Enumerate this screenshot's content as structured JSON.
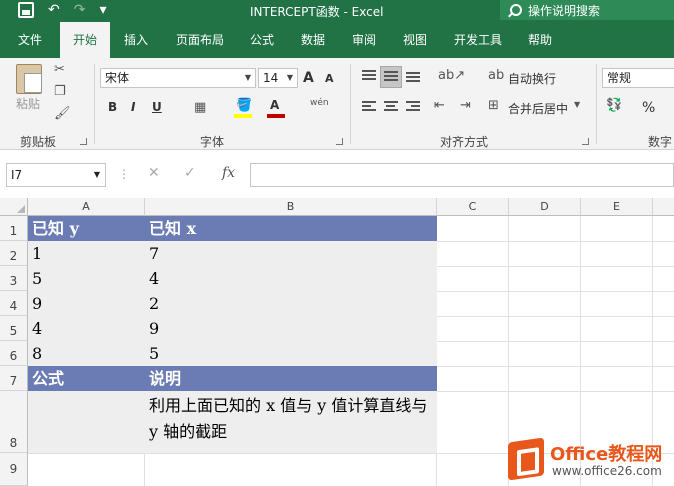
{
  "window": {
    "title": "INTERCEPT函数 - Excel",
    "tell_me": "操作说明搜索"
  },
  "qat": {
    "undo": "↶",
    "redo": "↷",
    "more": "▾"
  },
  "tabs": [
    {
      "label": "文件"
    },
    {
      "label": "开始"
    },
    {
      "label": "插入"
    },
    {
      "label": "页面布局"
    },
    {
      "label": "公式"
    },
    {
      "label": "数据"
    },
    {
      "label": "审阅"
    },
    {
      "label": "视图"
    },
    {
      "label": "开发工具"
    },
    {
      "label": "帮助"
    }
  ],
  "active_tab": "开始",
  "ribbon": {
    "clipboard": {
      "paste": "粘贴",
      "label": "剪贴板"
    },
    "font": {
      "name": "宋体",
      "size": "14",
      "grow": "A",
      "shrink": "A",
      "bold": "B",
      "italic": "I",
      "underline": "U",
      "label": "字体",
      "fill_color": "#ffff00",
      "font_color": "#c00000",
      "phonetic": "wén"
    },
    "alignment": {
      "wrap_text": "自动换行",
      "merge_center": "合并后居中",
      "label": "对齐方式"
    },
    "number": {
      "format": "常规",
      "percent": "%",
      "label": "数字"
    }
  },
  "formula_bar": {
    "name_box": "I7",
    "cancel": "✕",
    "enter": "✓",
    "fx": "fx",
    "content": ""
  },
  "columns": [
    "A",
    "B",
    "C",
    "D",
    "E"
  ],
  "rows": [
    "1",
    "2",
    "3",
    "4",
    "5",
    "6",
    "7",
    "8",
    "9"
  ],
  "sheet": {
    "header1": {
      "a": "已知 y",
      "b": "已知 x"
    },
    "data": [
      {
        "a": "1",
        "b": "7"
      },
      {
        "a": "5",
        "b": "4"
      },
      {
        "a": "9",
        "b": "2"
      },
      {
        "a": "4",
        "b": "9"
      },
      {
        "a": "8",
        "b": "5"
      }
    ],
    "header2": {
      "a": "公式",
      "b": "说明"
    },
    "row8": {
      "a": "",
      "b": "利用上面已知的 x 值与 y 值计算直线与 y 轴的截距"
    }
  },
  "watermark": {
    "line1": "Office教程网",
    "line2": "www.office26.com"
  },
  "colors": {
    "accent": "#217346",
    "table_header": "#6b7bb4",
    "shaded_row": "#eeeeee"
  }
}
